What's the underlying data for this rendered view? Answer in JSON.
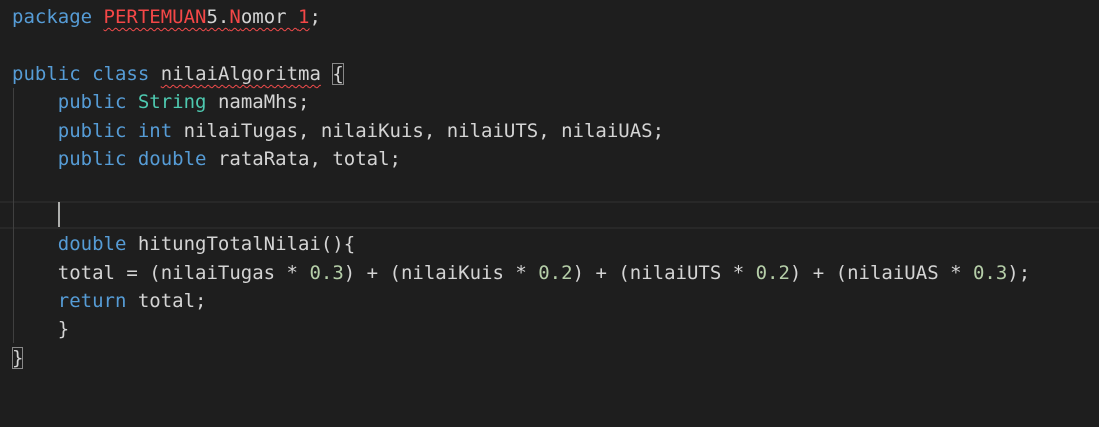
{
  "code": {
    "line1": {
      "kw": "package",
      "pkg_a": "PERTEMUAN",
      "pkg_b": "5.",
      "pkg_c": "N",
      "pkg_d": "omor ",
      "pkg_e": "1",
      "semi": ";"
    },
    "line3": {
      "kw1": "public",
      "kw2": "class",
      "classname": "nilaiAlgoritma",
      "brace": "{"
    },
    "line4": {
      "kw": "public",
      "type": "String",
      "rest": " namaMhs;"
    },
    "line5": {
      "kw": "public",
      "type": "int",
      "rest": " nilaiTugas, nilaiKuis, nilaiUTS, nilaiUAS;"
    },
    "line6": {
      "kw": "public",
      "type": "double",
      "rest": " rataRata, total;"
    },
    "line9": {
      "type": "double",
      "rest": " hitungTotalNilai(){"
    },
    "line10": {
      "p1": "total = (nilaiTugas * ",
      "n1": "0.3",
      "p2": ") + (nilaiKuis * ",
      "n2": "0.2",
      "p3": ") + (nilaiUTS * ",
      "n3": "0.2",
      "p4": ") + (nilaiUAS * ",
      "n4": "0.3",
      "p5": ");"
    },
    "line11": {
      "kw": "return",
      "rest": " total;"
    },
    "line12": {
      "brace": "}"
    },
    "line13": {
      "brace": "}"
    }
  }
}
